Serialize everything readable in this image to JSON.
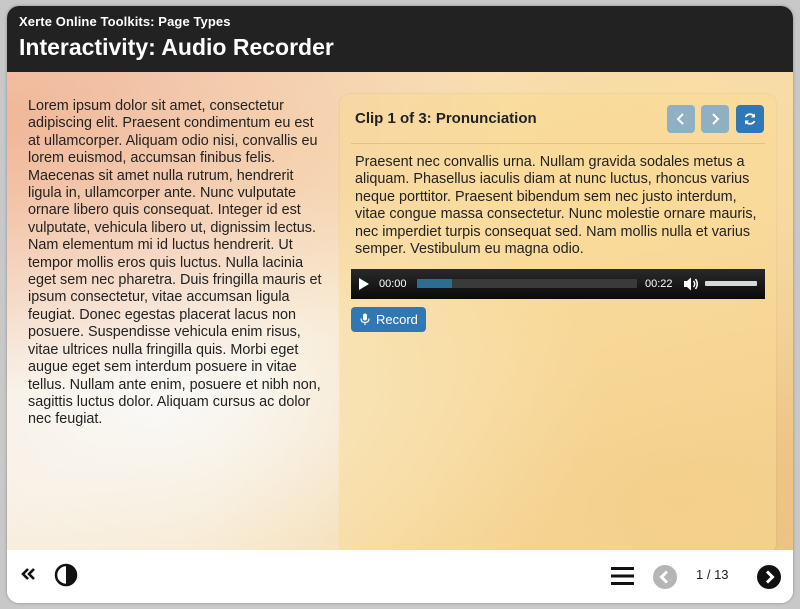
{
  "header": {
    "small_title": "Xerte Online Toolkits: Page Types",
    "title": "Interactivity: Audio Recorder"
  },
  "left_text": "Lorem ipsum dolor sit amet, consectetur adipiscing elit. Praesent condimentum eu est at ullamcorper. Aliquam odio nisi, convallis eu lorem euismod, accumsan finibus felis. Maecenas sit amet nulla rutrum, hendrerit ligula in, ullamcorper ante. Nunc vulputate ornare libero quis consequat. Integer id est vulputate, vehicula libero ut, dignissim lectus. Nam elementum mi id luctus hendrerit. Ut tempor mollis eros quis luctus. Nulla lacinia eget sem nec pharetra. Duis fringilla mauris et ipsum consectetur, vitae accumsan ligula feugiat. Donec egestas placerat lacus non posuere. Suspendisse vehicula enim risus, vitae ultrices nulla fringilla quis. Morbi eget augue eget sem interdum posuere in vitae tellus. Nullam ante enim, posuere et nibh non, sagittis luctus dolor. Aliquam cursus ac dolor nec feugiat.",
  "panel": {
    "title": "Clip 1 of 3: Pronunciation",
    "text": "Praesent nec convallis urna. Nullam gravida sodales metus a aliquam. Phasellus iaculis diam at nunc luctus, rhoncus varius neque porttitor. Praesent bibendum sem nec justo interdum, vitae congue massa consectetur. Nunc molestie ornare mauris, nec imperdiet turpis consequat sed. Nam mollis nulla et varius semper. Vestibulum eu magna odio.",
    "prev_icon": "chevron-left-icon",
    "next_icon": "chevron-right-icon",
    "reset_icon": "refresh-icon"
  },
  "audio": {
    "current_time": "00:00",
    "duration": "00:22",
    "buffered_fraction": 0.16
  },
  "record_label": "Record",
  "footer": {
    "page_current": "1",
    "page_total": "13",
    "page_label": "1 / 13"
  },
  "colors": {
    "header_bg": "#222222",
    "accent_blue": "#2f78b5",
    "disabled_blue": "#8fb0c2"
  }
}
